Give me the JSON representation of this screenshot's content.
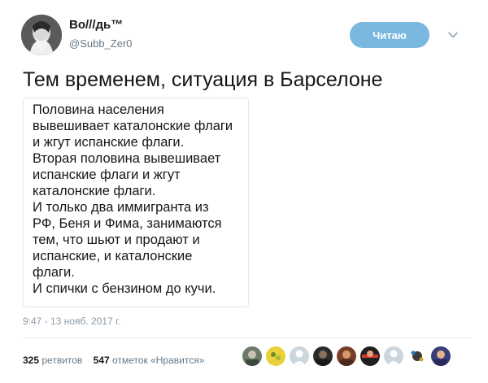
{
  "author": {
    "display_name": "Во///дь™",
    "handle": "@Subb_Zer0",
    "avatar_icon": "avatar-portrait-icon"
  },
  "actions": {
    "follow_label": "Читаю",
    "more_icon": "chevron-down-icon"
  },
  "tweet": {
    "text": "Тем временем, ситуация в Барселоне",
    "quote_lines": [
      "Половина населения",
      "вывешивает каталонские флаги",
      "и жгут испанские флаги.",
      "Вторая половина вывешивает",
      "испанские флаги и жгут",
      "каталонские флаги.",
      "И только два иммигранта из",
      "РФ, Беня и Фима, занимаются",
      "тем, что шьют и продают и",
      "испанские, и каталонские",
      "флаги.",
      "И спички с бензином до кучи."
    ],
    "timestamp": "9:47 - 13 нояб. 2017 г."
  },
  "stats": {
    "retweets_count": "325",
    "retweets_label": "ретвитов",
    "likes_count": "547",
    "likes_label": "отметок «Нравится»"
  },
  "likers": [
    "avatar-1",
    "avatar-2",
    "avatar-3",
    "avatar-4",
    "avatar-5",
    "avatar-6",
    "avatar-7",
    "avatar-8",
    "avatar-9"
  ],
  "colors": {
    "accent": "#7ab8e0",
    "text": "#14171a",
    "muted": "#657786",
    "border": "#e1e8ed"
  }
}
